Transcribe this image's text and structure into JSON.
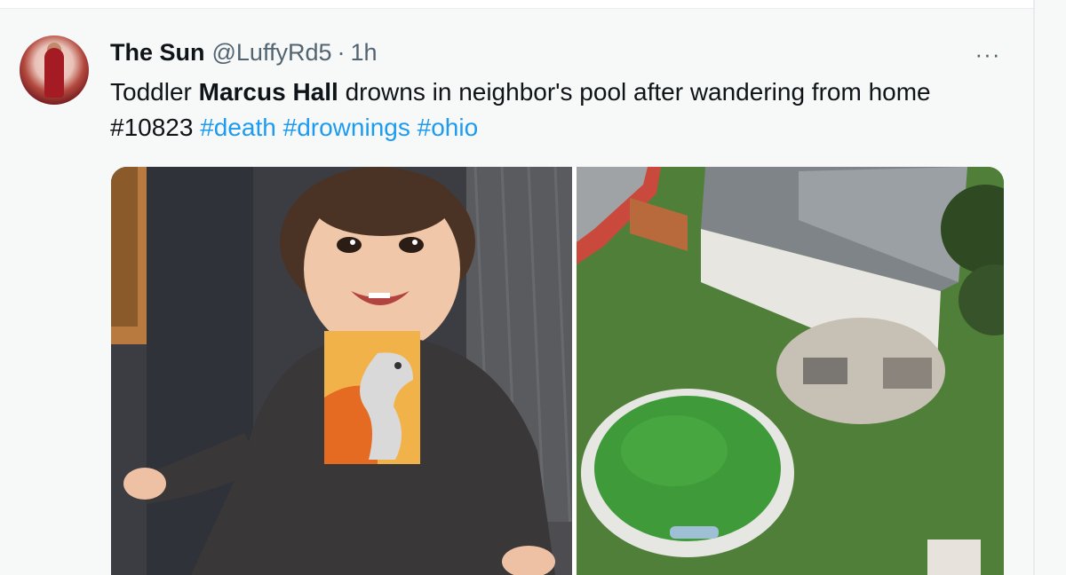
{
  "tweet": {
    "display_name": "The Sun",
    "handle": "@LuffyRd5",
    "separator": "·",
    "time": "1h",
    "more_label": "···",
    "text_pre": "Toddler ",
    "text_bold": "Marcus Hall",
    "text_post": " drowns in neighbor's pool after wandering from home",
    "tag_number": "#10823",
    "hashtags": [
      "#death",
      "#drownings",
      "#ohio"
    ]
  },
  "media": {
    "left_image": "toddler-in-dinosaur-sweater-photo",
    "right_image": "aerial-backyard-green-pool-photo"
  },
  "colors": {
    "link": "#1d9bf0",
    "text": "#0f1419",
    "secondary": "#536471",
    "background": "#f7f9f9"
  }
}
